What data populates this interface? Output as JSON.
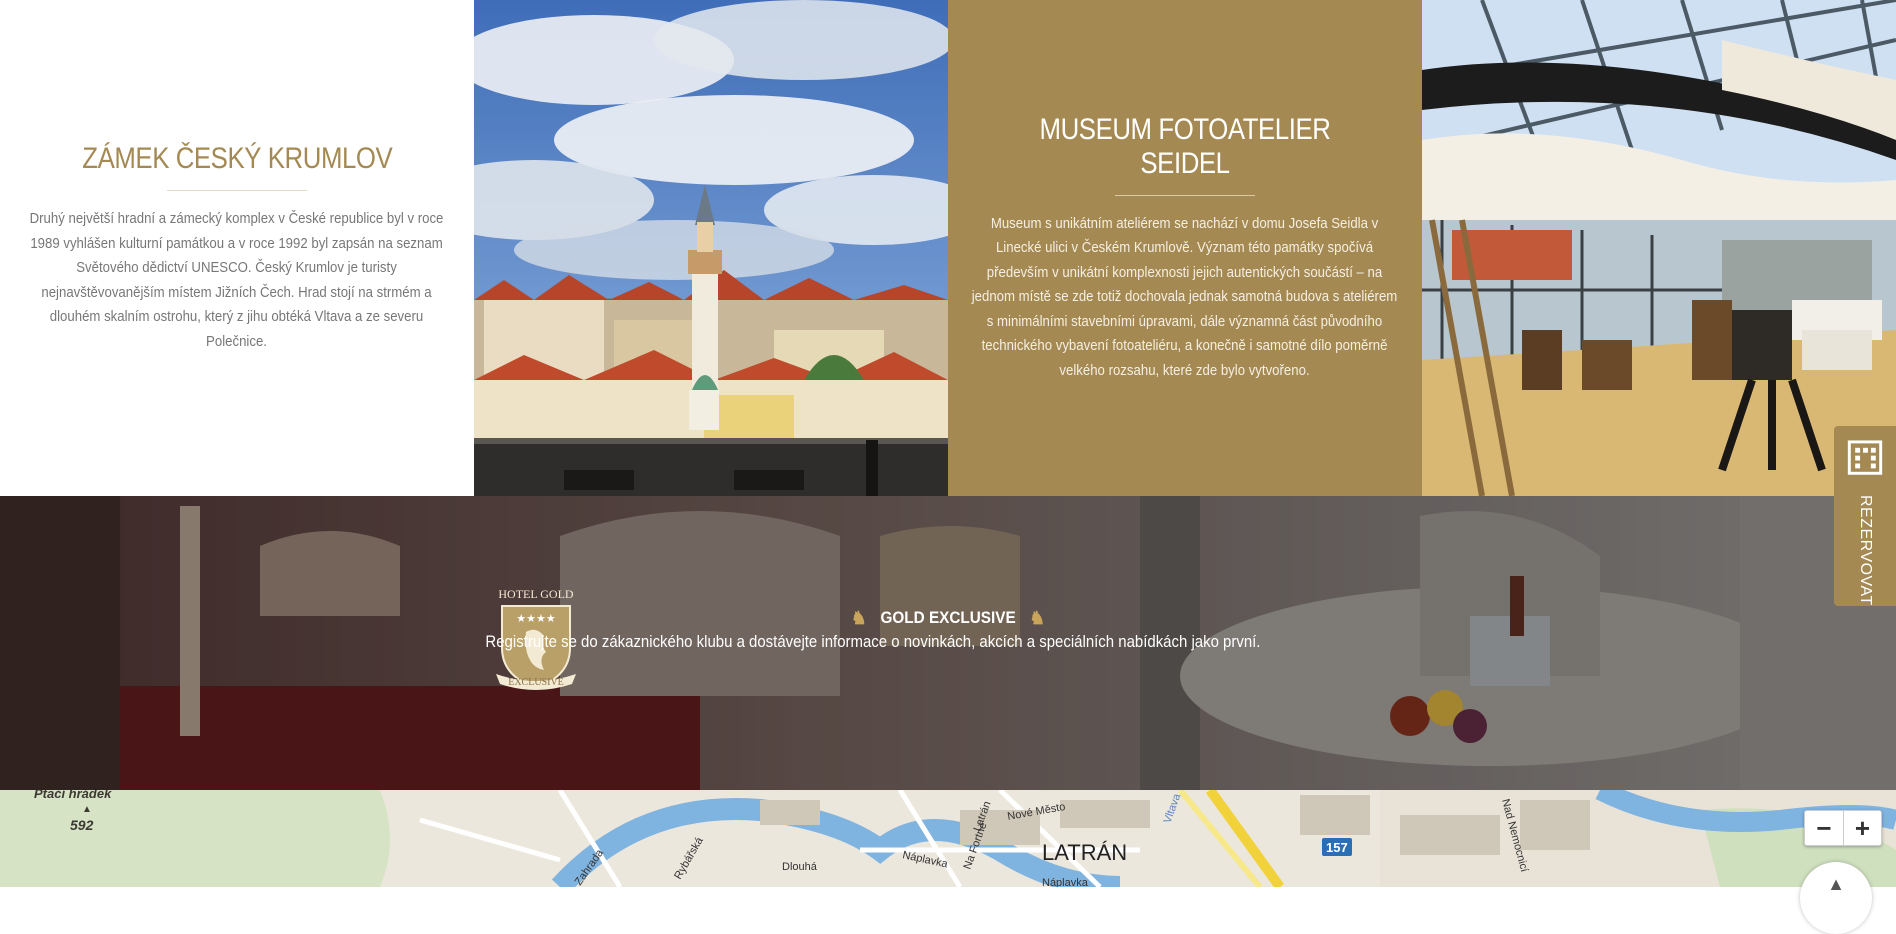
{
  "attractions": [
    {
      "title": "ZÁMEK ČESKÝ KRUMLOV",
      "description": "Druhý největší hradní a zámecký komplex v České republice byl v roce 1989 vyhlášen kulturní památkou a v roce 1992 byl zapsán na seznam Světového dědictví UNESCO. Český Krumlov je turisty nejnavštěvovanějším místem Jižních Čech. Hrad stojí na strmém a dlouhém skalním ostrohu, který z jihu obtéká Vltava a ze severu Polečnice."
    },
    {
      "title": "MUSEUM FOTOATELIER SEIDEL",
      "description": "Museum s unikátním ateliérem se nachází v domu Josefa Seidla v Linecké ulici v Českém Krumlově. Význam této památky spočívá především v unikátní komplexnosti jejich autentických součástí – na jednom místě se zde totiž dochovala jednak samotná budova s ateliérem s minimálními stavebními úpravami, dále významná část původního technického vybavení fotoateliéru, a konečně i samotné dílo poměrně velkého rozsahu, které zde bylo vytvořeno."
    }
  ],
  "club": {
    "badge_top": "HOTEL GOLD",
    "badge_bottom": "EXCLUSIVE",
    "title": "GOLD EXCLUSIVE",
    "text": "Registrujte se do zákaznického klubu a dostávejte informace o novinkách, akcích a speciálních nabídkách jako první."
  },
  "map": {
    "labels": {
      "hill": "Ptačí hrádek",
      "elevation": "592",
      "district": "LATRÁN",
      "road_number": "157",
      "street_1": "Rybářská",
      "street_2": "Dlouhá",
      "street_3": "Náplavka",
      "street_4": "Nové Město",
      "street_5": "Latrán",
      "street_6": "Na Fortně",
      "street_7": "Nad Nemocnicí",
      "street_8": "Vltava",
      "street_9": "Zahrada"
    },
    "zoom_out": "−",
    "zoom_in": "+"
  },
  "reserve": {
    "label": "REZERVOVAT"
  },
  "colors": {
    "brand_gold": "#a48953"
  }
}
